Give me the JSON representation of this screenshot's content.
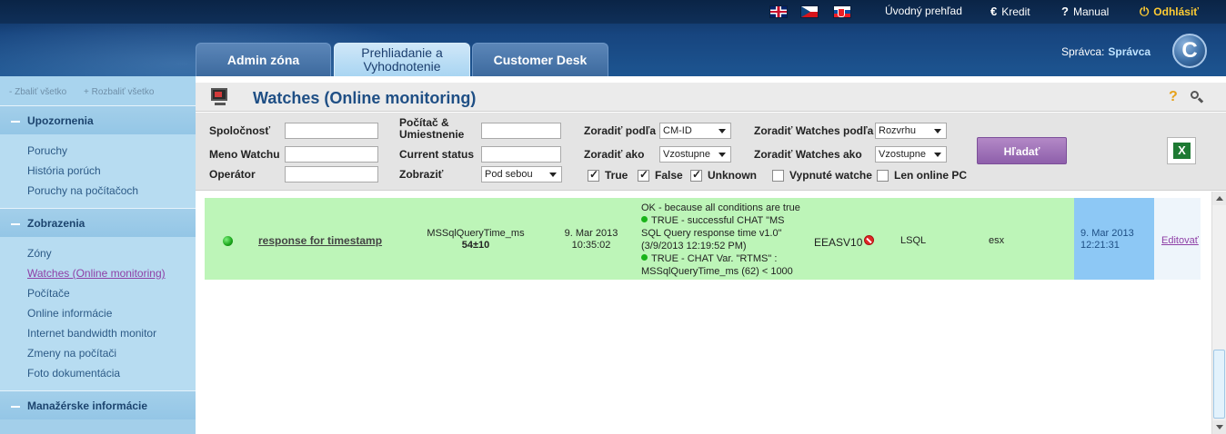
{
  "header": {
    "top_links": {
      "overview": "Úvodný prehľad",
      "credit": "Kredit",
      "manual": "Manual",
      "logout": "Odhlásiť"
    },
    "tabs": [
      "Admin zóna",
      "Prehliadanie a Vyhodnotenie",
      "Customer Desk"
    ],
    "admin_label": "Správca:",
    "admin_value": "Správca",
    "logo_letter": "C"
  },
  "sidebar": {
    "collapse_all": "- Zbaliť všetko",
    "expand_all": "+ Rozbaliť všetko",
    "sections": [
      {
        "title": "Upozornenia",
        "items": [
          "Poruchy",
          "História porúch",
          "Poruchy na počítačoch"
        ]
      },
      {
        "title": "Zobrazenia",
        "items": [
          "Zóny",
          "Watches (Online monitoring)",
          "Počítače",
          "Online informácie",
          "Internet bandwidth monitor",
          "Zmeny na počítači",
          "Foto dokumentácia"
        ]
      },
      {
        "title": "Manažérske informácie",
        "items": []
      }
    ],
    "active_item": "Watches (Online monitoring)"
  },
  "page": {
    "title": "Watches (Online monitoring)",
    "help_symbol": "?"
  },
  "filters": {
    "company_label": "Spoločnosť",
    "watch_name_label": "Meno Watchu",
    "operator_label": "Operátor",
    "pc_location_label": "Počítač & Umiestnenie",
    "current_status_label": "Current status",
    "show_label": "Zobraziť",
    "show_value": "Pod sebou",
    "sort_by_label": "Zoradiť podľa",
    "sort_by_value": "CM-ID",
    "sort_as_label": "Zoradiť ako",
    "sort_as_value": "Vzostupne",
    "sort_watches_by_label": "Zoradiť Watches podľa",
    "sort_watches_by_value": "Rozvrhu",
    "sort_watches_as_label": "Zoradiť Watches ako",
    "sort_watches_as_value": "Vzostupne",
    "checkboxes": [
      {
        "label": "True",
        "checked": true
      },
      {
        "label": "False",
        "checked": true
      },
      {
        "label": "Unknown",
        "checked": true
      },
      {
        "label": "Vypnuté watche",
        "checked": false
      },
      {
        "label": "Len online PC",
        "checked": false
      }
    ],
    "search_button": "Hľadať",
    "excel_icon": "excel-icon",
    "excel_letter": "X"
  },
  "results": [
    {
      "status": "green",
      "name": "response for timestamp",
      "type": "MSSqlQueryTime_ms",
      "type_value": "54±10",
      "time_date": "9. Mar 2013",
      "time_clock": "10:35:02",
      "desc_main": "OK - because all conditions are true",
      "desc_lines": [
        "TRUE - successful CHAT \"MS SQL Query response time v1.0\" (3/9/2013 12:19:52 PM)",
        "TRUE - CHAT Var. \"RTMS\" : MSSqlQueryTime_ms (62) < 1000"
      ],
      "pc": "EEASV10",
      "db": "LSQL",
      "env": "esx",
      "date": "9. Mar 2013",
      "date_time": "12:21:31",
      "edit": "Editovať"
    }
  ],
  "colors": {
    "row_ok": "#bdf5b8",
    "date_cell": "#8dc8f5",
    "title": "#1f4f85",
    "search_button": "#9a6bb5"
  }
}
